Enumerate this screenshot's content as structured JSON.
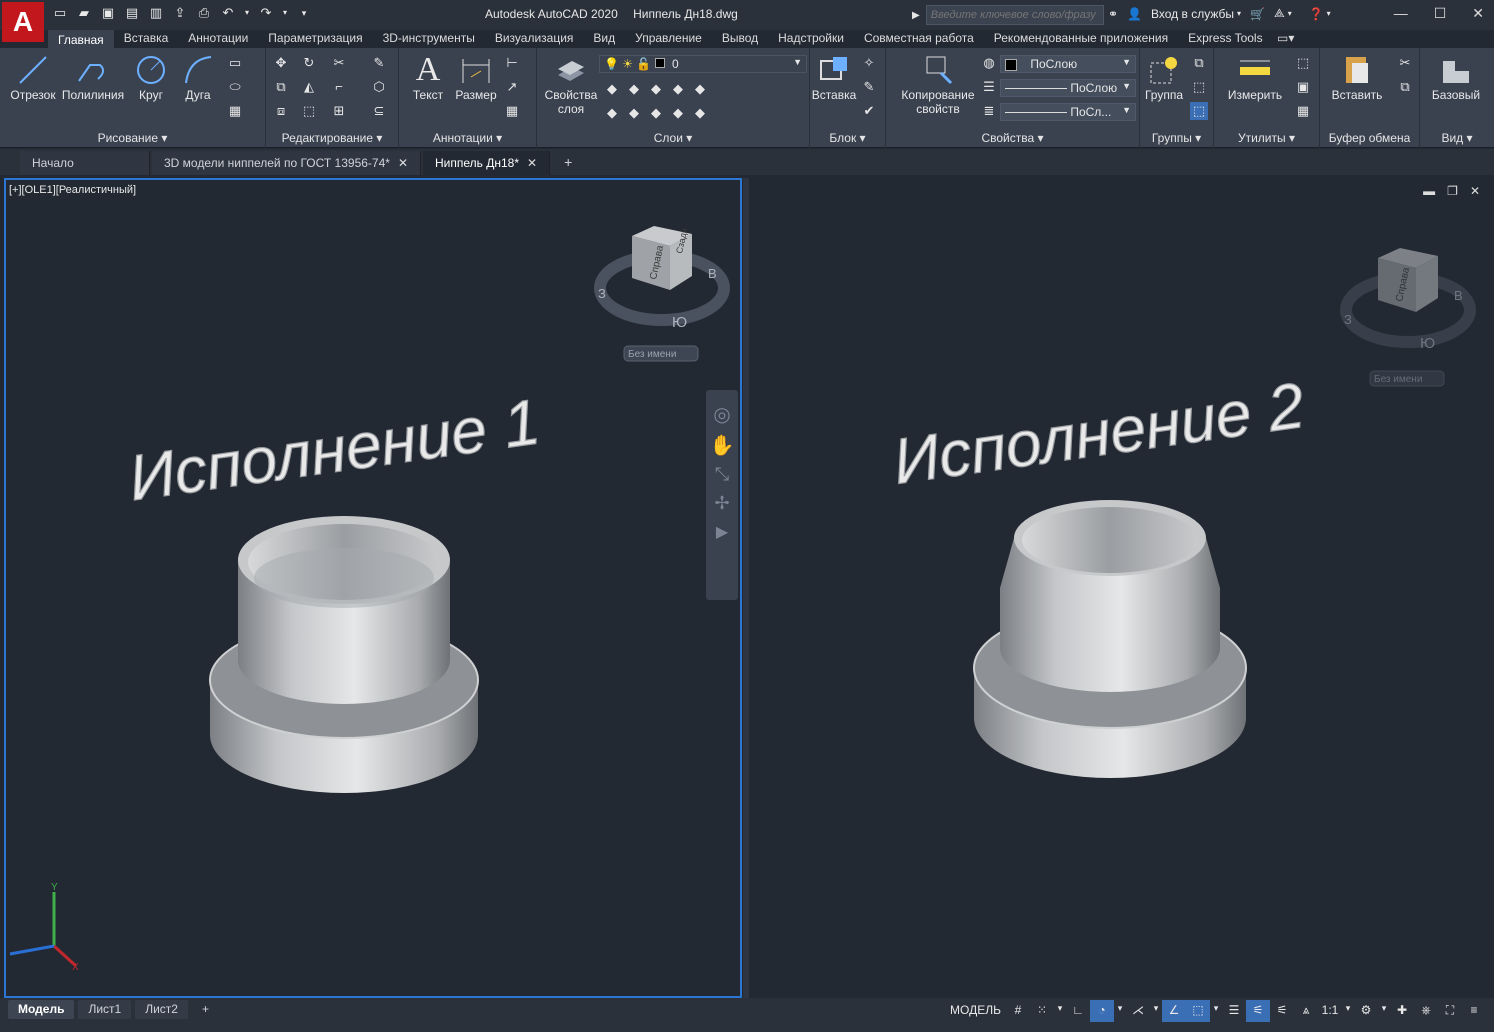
{
  "app": {
    "logo_letter": "A",
    "title_app": "Autodesk AutoCAD 2020",
    "title_file": "Ниппель Дн18.dwg"
  },
  "search": {
    "placeholder": "Введите ключевое слово/фразу"
  },
  "account": {
    "sign_in": "Вход в службы"
  },
  "ribbon_tabs": [
    "Главная",
    "Вставка",
    "Аннотации",
    "Параметризация",
    "3D-инструменты",
    "Визуализация",
    "Вид",
    "Управление",
    "Вывод",
    "Надстройки",
    "Совместная работа",
    "Рекомендованные приложения",
    "Express Tools"
  ],
  "ribbon": {
    "draw": {
      "title": "Рисование",
      "line": "Отрезок",
      "polyline": "Полилиния",
      "circle": "Круг",
      "arc": "Дуга"
    },
    "modify": {
      "title": "Редактирование"
    },
    "annotation": {
      "title": "Аннотации",
      "text": "Текст",
      "dimension": "Размер"
    },
    "layers": {
      "title": "Слои",
      "layer_props_line1": "Свойства",
      "layer_props_line2": "слоя",
      "current_layer": "0"
    },
    "block": {
      "title": "Блок",
      "insert": "Вставка"
    },
    "properties": {
      "title": "Свойства",
      "match_line1": "Копирование",
      "match_line2": "свойств",
      "color": "ПоСлою",
      "linetype": "ПоСлою",
      "lineweight": "ПоСл..."
    },
    "groups": {
      "title": "Группы",
      "group": "Группа"
    },
    "utilities": {
      "title": "Утилиты",
      "measure": "Измерить"
    },
    "clipboard": {
      "title": "Буфер обмена",
      "paste": "Вставить"
    },
    "view": {
      "title": "Вид",
      "base": "Базовый"
    }
  },
  "doc_tabs": [
    {
      "label": "Начало",
      "closable": false
    },
    {
      "label": "3D модели ниппелей по ГОСТ 13956-74*",
      "closable": true
    },
    {
      "label": "Ниппель Дн18*",
      "closable": true
    }
  ],
  "viewports": {
    "left": {
      "label": "[+][OLE1][Реалистичный]",
      "heading": "Исполнение 1",
      "viewcube_face": "Справа",
      "viewcube_top": "Сзади",
      "compass_w": "З",
      "compass_e": "В",
      "compass_s": "Ю",
      "ucs_name": "Без имени"
    },
    "right": {
      "heading": "Исполнение 2",
      "viewcube_face": "Справа",
      "compass_w": "З",
      "compass_e": "В",
      "compass_s": "Ю",
      "ucs_name": "Без имени"
    }
  },
  "layout_tabs": [
    "Модель",
    "Лист1",
    "Лист2"
  ],
  "status": {
    "model_label": "МОДЕЛЬ",
    "scale": "1:1"
  },
  "colors": {
    "accent": "#2a76d2",
    "logo_red": "#c2171d",
    "background": "#222933"
  }
}
